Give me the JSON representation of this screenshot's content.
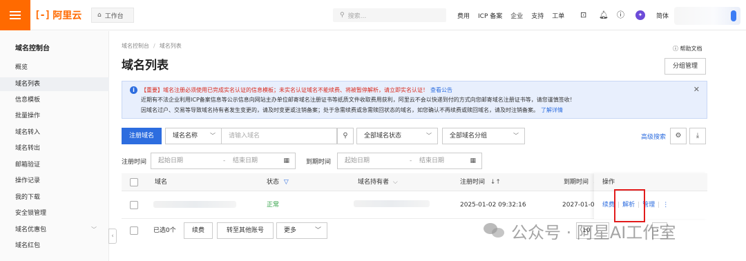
{
  "topbar": {
    "logo_text": "阿里云",
    "logo_mark": "[-]",
    "workbench": "工作台",
    "search_placeholder": "搜索...",
    "links": [
      "费用",
      "ICP 备案",
      "企业",
      "支持",
      "工单"
    ],
    "lang": "简体"
  },
  "sidebar": {
    "title": "域名控制台",
    "items": [
      {
        "label": "概览"
      },
      {
        "label": "域名列表",
        "active": true
      },
      {
        "label": "信息模板"
      },
      {
        "label": "批量操作"
      },
      {
        "label": "域名转入"
      },
      {
        "label": "域名转出"
      },
      {
        "label": "邮箱验证"
      },
      {
        "label": "操作记录"
      },
      {
        "label": "我的下载"
      },
      {
        "label": "安全锁管理"
      },
      {
        "label": "域名优惠包",
        "expandable": true
      },
      {
        "label": "域名红包"
      }
    ]
  },
  "page": {
    "breadcrumb": [
      "域名控制台",
      "域名列表"
    ],
    "title": "域名列表",
    "help": "帮助文档",
    "group_manage": "分组管理"
  },
  "notice": {
    "line1": "【重要】域名注册必须使用已完成实名认证的信息模板；未实名认证域名不能续费、将被暂停解析，请立即实名认证！",
    "line1_link": "查看公告",
    "line2": "近期有不法企业利用ICP备案信息等公示信息向网站主办单位邮寄域名注册证书等纸质文件收取费用获利，阿里云不会以快递到付的方式向您邮寄域名注册证书等，请您谨慎签收！",
    "line3": "因域名过户、交易等导致域名持有者发生变更的，请及时变更或注销备案；处于急需续费或急需赎回状态的域名，如您确认不再续费或赎回域名，请及时注销备案。",
    "line3_link": "了解详情"
  },
  "filters": {
    "register_button": "注册域名",
    "field_select": "域名名称",
    "domain_placeholder": "请输入域名",
    "status_select": "全部域名状态",
    "group_select": "全部域名分组",
    "advanced_search": "高级搜索",
    "reg_time_label": "注册时间",
    "exp_time_label": "到期时间",
    "start_date": "起始日期",
    "end_date": "结束日期"
  },
  "table": {
    "headers": {
      "domain": "域名",
      "status": "状态",
      "owner": "域名持有者",
      "reg_time": "注册时间",
      "exp_time": "到期时间",
      "ops": "操作"
    },
    "rows": [
      {
        "status": "正常",
        "reg_time": "2025-01-02 09:32:16",
        "exp_time": "2027-01-0",
        "ops": [
          "续费",
          "解析",
          "管理"
        ]
      }
    ]
  },
  "footer": {
    "selected": "已选0个",
    "renew": "续费",
    "transfer": "转至其他账号",
    "more": "更多",
    "page_size": "10"
  },
  "watermark": "公众号 · 阿星AI工作室",
  "colors": {
    "brand": "#ff6a00",
    "primary": "#2d6ddf",
    "notice_bg": "#e8effd",
    "warning_red": "#d9291c",
    "status_green": "#2ea043",
    "highlight_box": "#e21b1b"
  }
}
